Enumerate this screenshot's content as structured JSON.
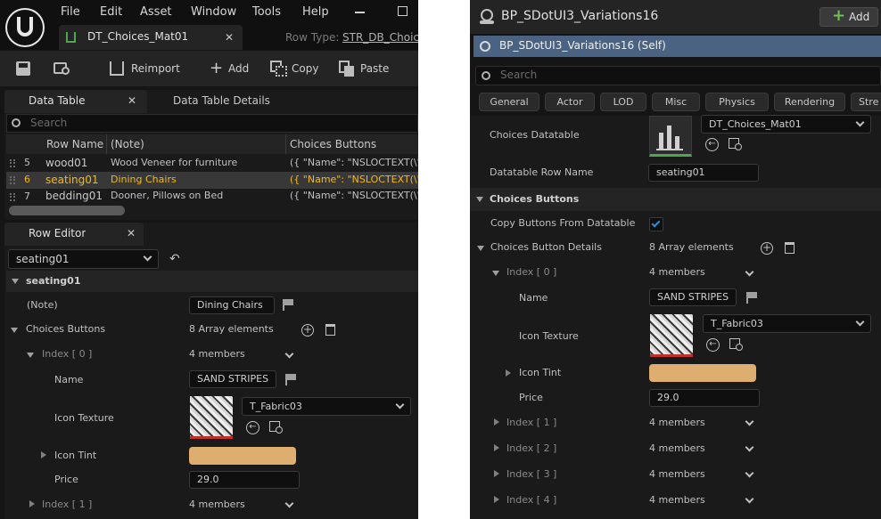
{
  "left": {
    "menu": [
      "File",
      "Edit",
      "Asset",
      "Window",
      "Tools",
      "Help"
    ],
    "doc_tab": "DT_Choices_Mat01",
    "row_type_label": "Row Type:",
    "row_type_value": "STR_DB_Choic",
    "toolbar": {
      "reimport": "Reimport",
      "add": "Add",
      "copy": "Copy",
      "paste": "Paste"
    },
    "panel_tabs": {
      "data_table": "Data Table",
      "details": "Data Table Details"
    },
    "search_placeholder": "Search",
    "columns": [
      "Row Name",
      "(Note)",
      "Choices Buttons"
    ],
    "rows": [
      {
        "index": "5",
        "name": "wood01",
        "note": "Wood Veneer for furniture",
        "buttons": "({ \"Name\": \"NSLOCTEXT(\\\"["
      },
      {
        "index": "6",
        "name": "seating01",
        "note": "Dining Chairs",
        "buttons": "({ \"Name\": \"NSLOCTEXT(\\\"["
      },
      {
        "index": "7",
        "name": "bedding01",
        "note": "Dooner, Pillows on Bed",
        "buttons": "({ \"Name\": \"NSLOCTEXT(\\\"["
      }
    ],
    "row_editor_tab": "Row Editor",
    "row_select": "seating01",
    "section_title": "seating01",
    "note_label": "(Note)",
    "note_value": "Dining Chairs",
    "choices_label": "Choices Buttons",
    "choices_value": "8 Array elements",
    "index0_label": "Index [ 0 ]",
    "index0_value": "4 members",
    "name_label": "Name",
    "name_value": "SAND STRIPES",
    "icon_texture_label": "Icon Texture",
    "icon_texture_value": "T_Fabric03",
    "icon_tint_label": "Icon Tint",
    "tint_color": "#deae70",
    "price_label": "Price",
    "price_value": "29.0",
    "index1_label": "Index [ 1 ]",
    "index1_value": "4 members"
  },
  "right": {
    "title": "BP_SDotUI3_Variations16",
    "add_label": "Add",
    "self_label": "BP_SDotUI3_Variations16 (Self)",
    "search_placeholder": "Search",
    "filters": [
      "General",
      "Actor",
      "LOD",
      "Misc",
      "Physics",
      "Rendering",
      "Stre"
    ],
    "datatable_label": "Choices Datatable",
    "datatable_value": "DT_Choices_Mat01",
    "row_name_label": "Datatable Row Name",
    "row_name_value": "seating01",
    "section_label": "Choices Buttons",
    "copy_label": "Copy Buttons From Datatable",
    "details_label": "Choices Button Details",
    "details_value": "8 Array elements",
    "index0_label": "Index [ 0 ]",
    "index0_value": "4 members",
    "name_label": "Name",
    "name_value": "SAND STRIPES",
    "icon_label": "Icon Texture",
    "icon_value": "T_Fabric03",
    "tint_label": "Icon Tint",
    "tint_color": "#deae70",
    "price_label": "Price",
    "price_value": "29.0",
    "indices": [
      {
        "label": "Index [ 1 ]",
        "value": "4 members"
      },
      {
        "label": "Index [ 2 ]",
        "value": "4 members"
      },
      {
        "label": "Index [ 3 ]",
        "value": "4 members"
      },
      {
        "label": "Index [ 4 ]",
        "value": "4 members"
      }
    ]
  }
}
